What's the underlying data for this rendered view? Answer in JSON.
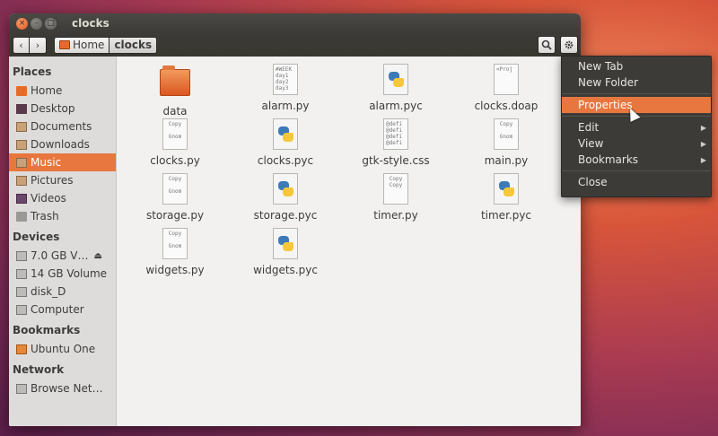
{
  "window": {
    "title": "clocks"
  },
  "toolbar": {
    "back_icon": "chevron-left-icon",
    "forward_icon": "chevron-right-icon",
    "breadcrumbs": [
      "Home",
      "clocks"
    ],
    "search_icon": "search-icon",
    "settings_icon": "gear-icon"
  },
  "sidebar": {
    "sections": [
      {
        "title": "Places",
        "items": [
          "Home",
          "Desktop",
          "Documents",
          "Downloads",
          "Music",
          "Pictures",
          "Videos",
          "Trash"
        ]
      },
      {
        "title": "Devices",
        "items": [
          "7.0 GB V…",
          "14 GB Volume",
          "disk_D",
          "Computer"
        ]
      },
      {
        "title": "Bookmarks",
        "items": [
          "Ubuntu One"
        ]
      },
      {
        "title": "Network",
        "items": [
          "Browse Net…"
        ]
      }
    ],
    "active_item": "Music"
  },
  "files": [
    {
      "name": "data",
      "type": "folder"
    },
    {
      "name": "alarm.py",
      "type": "text",
      "preview": [
        "#WEEK",
        "day1",
        "day2",
        "day3"
      ]
    },
    {
      "name": "alarm.pyc",
      "type": "python"
    },
    {
      "name": "clocks.doap",
      "type": "text",
      "preview": [
        "<Proj"
      ]
    },
    {
      "name": "clocks.py",
      "type": "text",
      "preview": [
        "Copy",
        "",
        "Gnom"
      ]
    },
    {
      "name": "clocks.pyc",
      "type": "python"
    },
    {
      "name": "gtk-style.css",
      "type": "text",
      "preview": [
        "@defi",
        "@defi",
        "@defi",
        "@defi"
      ]
    },
    {
      "name": "main.py",
      "type": "text",
      "preview": [
        "Copy",
        "",
        "Gnom"
      ]
    },
    {
      "name": "storage.py",
      "type": "text",
      "preview": [
        "Copy",
        "",
        "Gnom"
      ]
    },
    {
      "name": "storage.pyc",
      "type": "python"
    },
    {
      "name": "timer.py",
      "type": "text",
      "preview": [
        "Copy",
        "Copy"
      ]
    },
    {
      "name": "timer.pyc",
      "type": "python"
    },
    {
      "name": "widgets.py",
      "type": "text",
      "preview": [
        "Copy",
        "",
        "Gnom"
      ]
    },
    {
      "name": "widgets.pyc",
      "type": "python"
    }
  ],
  "context_menu": {
    "items": [
      {
        "label": "New Tab"
      },
      {
        "label": "New Folder"
      },
      {
        "separator": true
      },
      {
        "label": "Properties",
        "highlighted": true
      },
      {
        "separator": true
      },
      {
        "label": "Edit",
        "submenu": true
      },
      {
        "label": "View",
        "submenu": true
      },
      {
        "label": "Bookmarks",
        "submenu": true
      },
      {
        "separator": true
      },
      {
        "label": "Close"
      }
    ]
  },
  "colors": {
    "accent": "#e8773f",
    "titlebar": "#3c3b37",
    "sidebar": "#dedcda",
    "content": "#f2f1f0"
  }
}
